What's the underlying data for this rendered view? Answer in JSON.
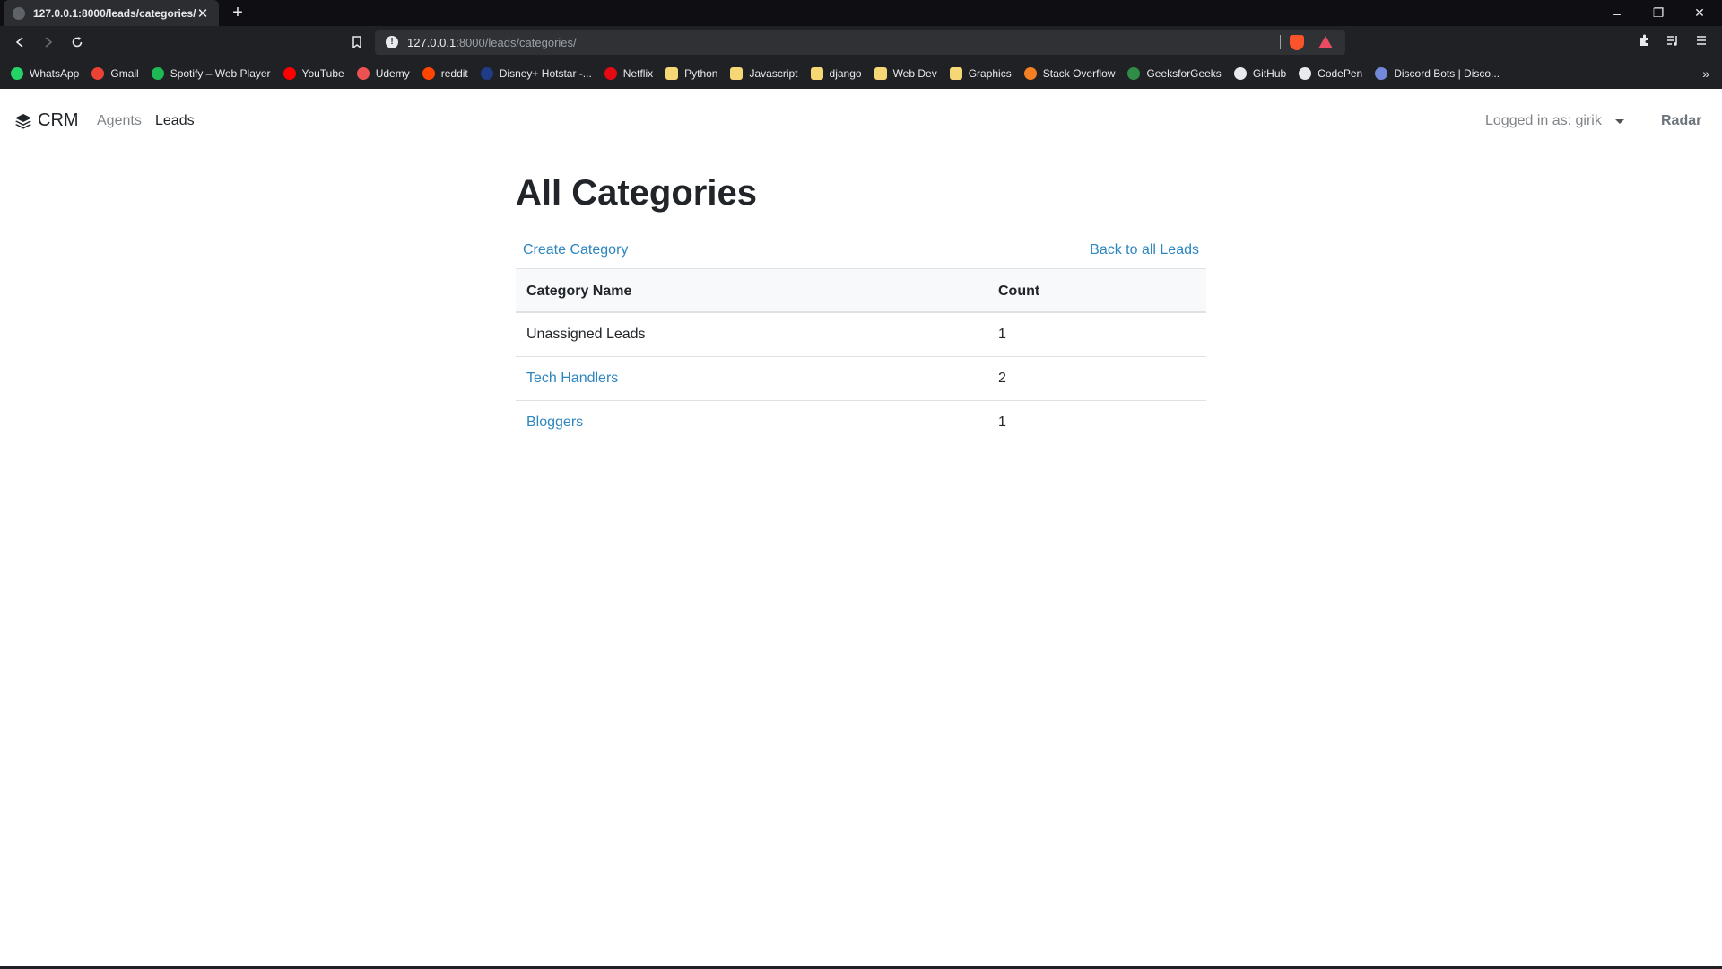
{
  "browser": {
    "tab_title": "127.0.0.1:8000/leads/categories/",
    "tab_close": "✕",
    "new_tab": "+",
    "url_host": "127.0.0.1",
    "url_path": ":8000/leads/categories/",
    "window_controls": [
      "–",
      "❐",
      "✕"
    ],
    "bookmarks": [
      {
        "label": "WhatsApp",
        "icon": "whatsapp-icon",
        "color": "#25d366"
      },
      {
        "label": "Gmail",
        "icon": "gmail-icon",
        "color": "#ea4335"
      },
      {
        "label": "Spotify – Web Player",
        "icon": "spotify-icon",
        "color": "#1db954"
      },
      {
        "label": "YouTube",
        "icon": "youtube-icon",
        "color": "#ff0000"
      },
      {
        "label": "Udemy",
        "icon": "udemy-icon",
        "color": "#ec5252"
      },
      {
        "label": "reddit",
        "icon": "reddit-icon",
        "color": "#ff4500"
      },
      {
        "label": "Disney+ Hotstar -...",
        "icon": "hotstar-icon",
        "color": "#1f3c88"
      },
      {
        "label": "Netflix",
        "icon": "netflix-icon",
        "color": "#e50914"
      },
      {
        "label": "Python",
        "icon": "folder-icon",
        "color": "#f6d776"
      },
      {
        "label": "Javascript",
        "icon": "folder-icon",
        "color": "#f6d776"
      },
      {
        "label": "django",
        "icon": "folder-icon",
        "color": "#f6d776"
      },
      {
        "label": "Web Dev",
        "icon": "folder-icon",
        "color": "#f6d776"
      },
      {
        "label": "Graphics",
        "icon": "folder-icon",
        "color": "#f6d776"
      },
      {
        "label": "Stack Overflow",
        "icon": "stackoverflow-icon",
        "color": "#f48024"
      },
      {
        "label": "GeeksforGeeks",
        "icon": "geeksforgeeks-icon",
        "color": "#2f8d46"
      },
      {
        "label": "GitHub",
        "icon": "github-icon",
        "color": "#e8eaed"
      },
      {
        "label": "CodePen",
        "icon": "codepen-icon",
        "color": "#e8eaed"
      },
      {
        "label": "Discord Bots | Disco...",
        "icon": "discord-icon",
        "color": "#7289da"
      }
    ],
    "bookmarks_more": "»"
  },
  "navbar": {
    "brand": "CRM",
    "links": [
      "Agents",
      "Leads"
    ],
    "logged_in": "Logged in as: girik",
    "user_name": "Radar"
  },
  "page": {
    "title": "All Categories",
    "create_link": "Create Category",
    "back_link": "Back to all Leads"
  },
  "table": {
    "headers": [
      "Category Name",
      "Count"
    ],
    "rows": [
      {
        "name": "Unassigned Leads",
        "count": "1",
        "is_link": false
      },
      {
        "name": "Tech Handlers",
        "count": "2",
        "is_link": true
      },
      {
        "name": "Bloggers",
        "count": "1",
        "is_link": true
      }
    ]
  },
  "colors": {
    "link": "#2e86c1",
    "chrome_bg": "#202124"
  }
}
